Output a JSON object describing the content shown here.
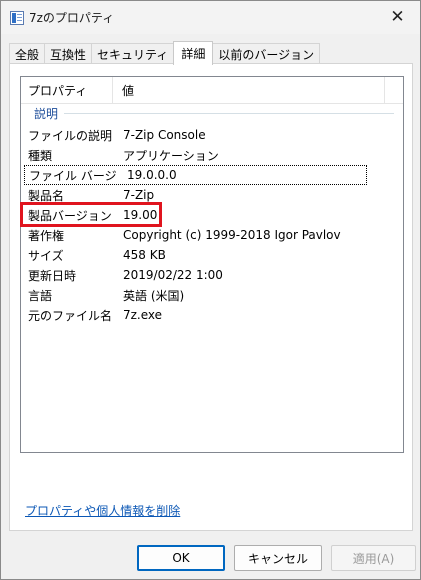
{
  "window": {
    "title": "7zのプロパティ"
  },
  "tabs": [
    {
      "label": "全般"
    },
    {
      "label": "互換性"
    },
    {
      "label": "セキュリティ"
    },
    {
      "label": "詳細"
    },
    {
      "label": "以前のバージョン"
    }
  ],
  "active_tab": "詳細",
  "details": {
    "col_property": "プロパティ",
    "col_value": "値",
    "group_label": "説明",
    "rows": [
      {
        "property": "ファイルの説明",
        "value": "7-Zip Console"
      },
      {
        "property": "種類",
        "value": "アプリケーション"
      },
      {
        "property": "ファイル バージョン",
        "value": "19.0.0.0"
      },
      {
        "property": "製品名",
        "value": "7-Zip"
      },
      {
        "property": "製品バージョン",
        "value": "19.00"
      },
      {
        "property": "著作権",
        "value": "Copyright (c) 1999-2018 Igor Pavlov"
      },
      {
        "property": "サイズ",
        "value": "458 KB"
      },
      {
        "property": "更新日時",
        "value": "2019/02/22 1:00"
      },
      {
        "property": "言語",
        "value": "英語 (米国)"
      },
      {
        "property": "元のファイル名",
        "value": "7z.exe"
      }
    ]
  },
  "links": {
    "remove_properties": "プロパティや個人情報を削除"
  },
  "buttons": {
    "ok": "OK",
    "cancel": "キャンセル",
    "apply": "適用(A)"
  },
  "icons": {
    "window": "file-properties-icon",
    "close": "close-icon"
  },
  "colors": {
    "highlight": "#e0141e",
    "link": "#0b57b5",
    "group": "#1e4e9a",
    "ok_border": "#0067c0"
  }
}
